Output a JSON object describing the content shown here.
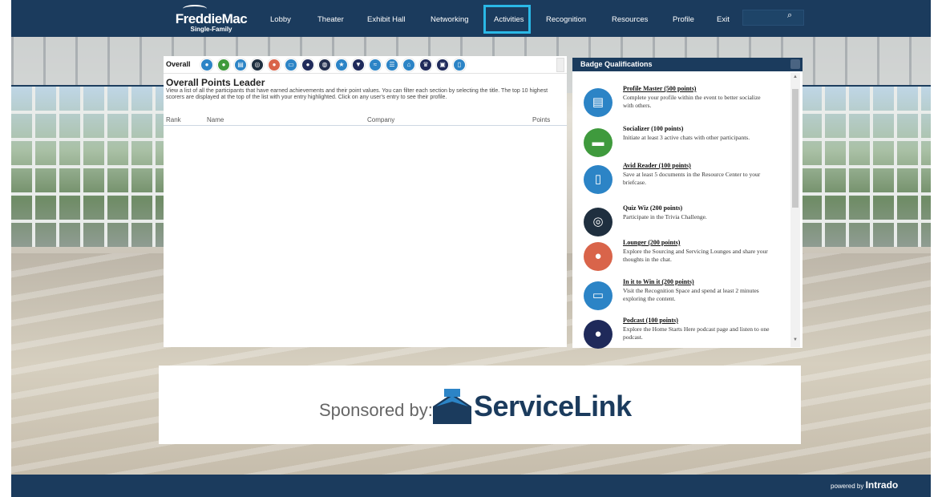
{
  "brand": {
    "name": "FreddieMac",
    "sub": "Single-Family"
  },
  "nav": {
    "items": [
      {
        "label": "Lobby"
      },
      {
        "label": "Theater"
      },
      {
        "label": "Exhibit Hall"
      },
      {
        "label": "Networking"
      },
      {
        "label": "Activities",
        "active": true
      },
      {
        "label": "Recognition"
      },
      {
        "label": "Resources"
      },
      {
        "label": "Profile"
      },
      {
        "label": "Exit"
      }
    ],
    "search_icon": "search-icon"
  },
  "leaderboard": {
    "tab_label": "Overall",
    "badge_icons": [
      "profile-badge-icon",
      "chat-badge-icon",
      "document-badge-icon",
      "quiz-badge-icon",
      "lounge-badge-icon",
      "laptop-badge-icon",
      "podcast-badge-icon",
      "globe-badge-icon",
      "star-badge-icon",
      "ribbon-badge-icon",
      "wifi-badge-icon",
      "checklist-badge-icon",
      "home-badge-icon",
      "crown-badge-icon",
      "trophy-badge-icon",
      "phone-badge-icon"
    ],
    "title": "Overall Points Leader",
    "description": "View a list of all the participants that have earned achievements and their point values. You can filter each section by selecting the title. The top 10 highest scorers are displayed at the top of the list with your entry highlighted. Click on any user's entry to see their profile.",
    "columns": [
      "Rank",
      "Name",
      "Company",
      "Points"
    ]
  },
  "badge_qualifications": {
    "title": "Badge Qualifications",
    "items": [
      {
        "name": "Profile Master  (500 points)",
        "text": "Complete your profile within the event to better socialize with others.",
        "color": "#2c84c6",
        "icon": "profile-icon"
      },
      {
        "name": "Socializer (100 points)",
        "text": "Initiate at least 3 active chats with other participants.",
        "color": "#3f9a3d",
        "icon": "chat-icon"
      },
      {
        "name": "Avid Reader  (100 points)",
        "text": "Save at least 5 documents in the Resource Center to your briefcase.",
        "color": "#2c84c6",
        "icon": "document-icon"
      },
      {
        "name": "Quiz Wiz (200 points)",
        "text": "Participate in the Trivia Challenge.",
        "color": "#1f2f3f",
        "icon": "quiz-icon"
      },
      {
        "name": "Lounger (200 points)",
        "text": "Explore the Sourcing and Servicing Lounges and share your thoughts in the chat.",
        "color": "#d9644a",
        "icon": "lounge-icon"
      },
      {
        "name": "In it to Win it (200 points)",
        "text": "Visit the Recognition Space and spend at least 2 minutes exploring the content.",
        "color": "#2c84c6",
        "icon": "laptop-icon"
      },
      {
        "name": "Podcast (100 points)",
        "text": "Explore the Home Starts Here podcast page and listen to one podcast.",
        "color": "#1f2a5a",
        "icon": "microphone-icon"
      }
    ]
  },
  "sponsor": {
    "label": "Sponsored by:",
    "name": "ServiceLink"
  },
  "footer": {
    "powered_by": "powered by",
    "vendor": "Intrado"
  }
}
